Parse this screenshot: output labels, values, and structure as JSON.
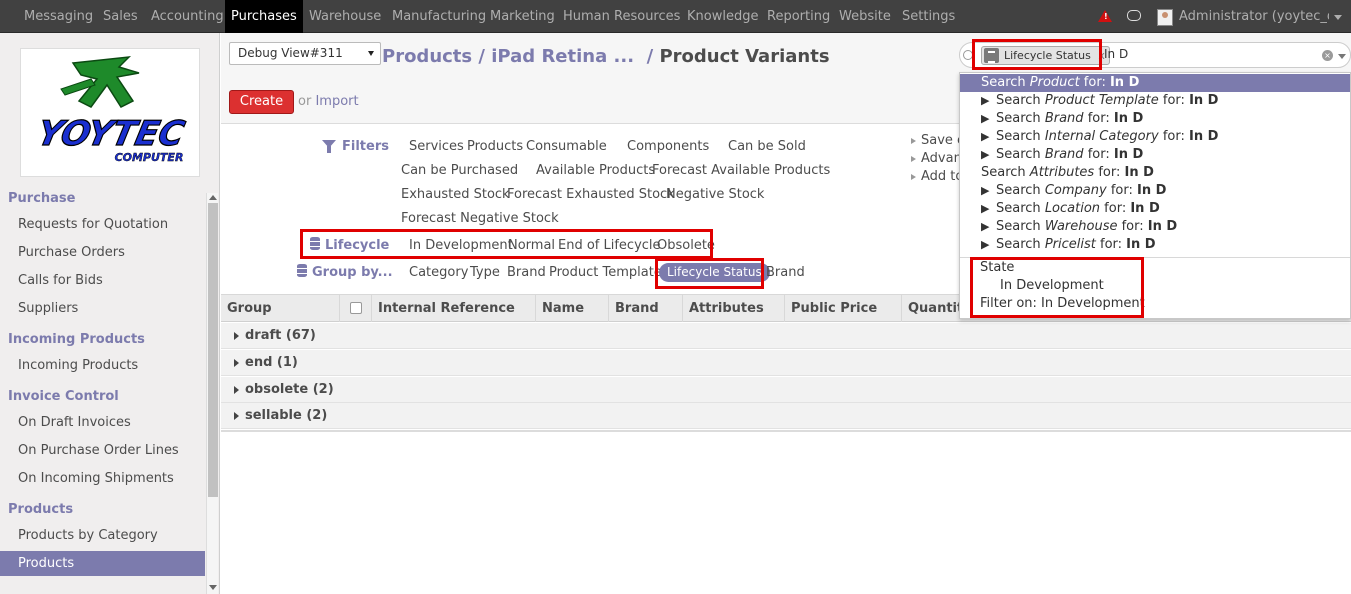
{
  "topbar": {
    "menus": [
      "Messaging",
      "Sales",
      "Accounting",
      "Purchases",
      "Warehouse",
      "Manufacturing",
      "Marketing",
      "Human Resources",
      "Knowledge",
      "Reporting",
      "Website",
      "Settings"
    ],
    "active_menu": "Purchases",
    "user": "Administrator (yoytec_d..."
  },
  "logo": {
    "text_main": "YOYTEC",
    "text_sub": "COMPUTER"
  },
  "sidebar": {
    "sections": [
      {
        "title": "Purchase",
        "items": [
          "Requests for Quotation",
          "Purchase Orders",
          "Calls for Bids",
          "Suppliers"
        ]
      },
      {
        "title": "Incoming Products",
        "items": [
          "Incoming Products"
        ]
      },
      {
        "title": "Invoice Control",
        "items": [
          "On Draft Invoices",
          "On Purchase Order Lines",
          "On Incoming Shipments"
        ]
      },
      {
        "title": "Products",
        "items": [
          "Products by Category",
          "Products"
        ]
      }
    ],
    "selected_item": "Products"
  },
  "header": {
    "debug_select": "Debug View#311",
    "breadcrumb_parts": [
      "Products",
      "iPad Retina ..."
    ],
    "breadcrumb_sep": "/",
    "current": "Product Variants",
    "create_label": "Create",
    "or_label": "or",
    "import_label": "Import"
  },
  "search": {
    "facet_label": "Lifecycle Status",
    "facet_remove": "x",
    "query": "In D"
  },
  "filters": {
    "filters_label": "Filters",
    "filter_rows": [
      [
        "Services",
        "Products",
        "Consumable",
        "Components",
        "Can be Sold"
      ],
      [
        "Can be Purchased",
        "Available Products",
        "Forecast Available Products"
      ],
      [
        "Exhausted Stock",
        "Forecast Exhausted Stock",
        "Negative Stock"
      ],
      [
        "Forecast Negative Stock"
      ]
    ],
    "lifecycle_label": "Lifecycle",
    "lifecycle_options": [
      "In Development",
      "Normal",
      "End of Lifecycle",
      "Obsolete"
    ],
    "groupby_label": "Group by...",
    "groupby_options": [
      "Category",
      "Type",
      "Brand",
      "Product Template",
      "Lifecycle Status",
      "Brand"
    ],
    "groupby_active": "Lifecycle Status",
    "side_actions": [
      "Save c",
      "Advanc",
      "Add to"
    ]
  },
  "list": {
    "columns": [
      "Group",
      "",
      "Internal Reference",
      "Name",
      "Brand",
      "Attributes",
      "Public Price",
      "Quantity"
    ],
    "groups": [
      "draft (67)",
      "end (1)",
      "obsolete (2)",
      "sellable (2)"
    ]
  },
  "autocomplete": {
    "top": {
      "prefix": "Search ",
      "field": "Product",
      "mid": " for: ",
      "term": "In D"
    },
    "expandable": [
      {
        "field": "Product Template",
        "term": "In D"
      },
      {
        "field": "Brand",
        "term": "In D"
      },
      {
        "field": "Internal Category",
        "term": "In D"
      },
      {
        "field": "Brand",
        "term": "In D"
      }
    ],
    "plain": {
      "prefix": "Search ",
      "field": "Attributes",
      "mid": " for: ",
      "term": "In D"
    },
    "expandable2": [
      {
        "field": "Company",
        "term": "In D"
      },
      {
        "field": "Location",
        "term": "In D"
      },
      {
        "field": "Warehouse",
        "term": "In D"
      },
      {
        "field": "Pricelist",
        "term": "In D"
      }
    ],
    "search_word": "Search",
    "for_word": "for:",
    "state_label": "State",
    "state_option": "In Development",
    "filter_on": "Filter on: In Development"
  },
  "colors": {
    "accent": "#7c7bad",
    "highlight_box": "#e00000",
    "create_button": "#dc3030",
    "topbar": "#414141"
  }
}
